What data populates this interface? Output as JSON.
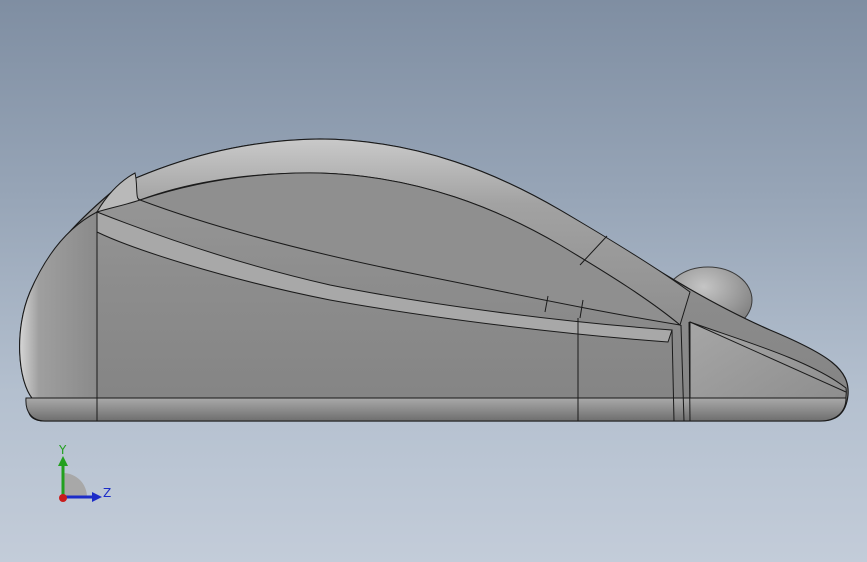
{
  "viewport": {
    "background_top": "#7f8ea2",
    "background_bottom": "#c3ccd9",
    "model_color": "#8f8f8f",
    "edge_color": "#1a1a1a"
  },
  "triad": {
    "y_label": "Y",
    "z_label": "Z",
    "y_color": "#22a01e",
    "z_color": "#1c2cc8",
    "x_color": "#c81c1c"
  }
}
